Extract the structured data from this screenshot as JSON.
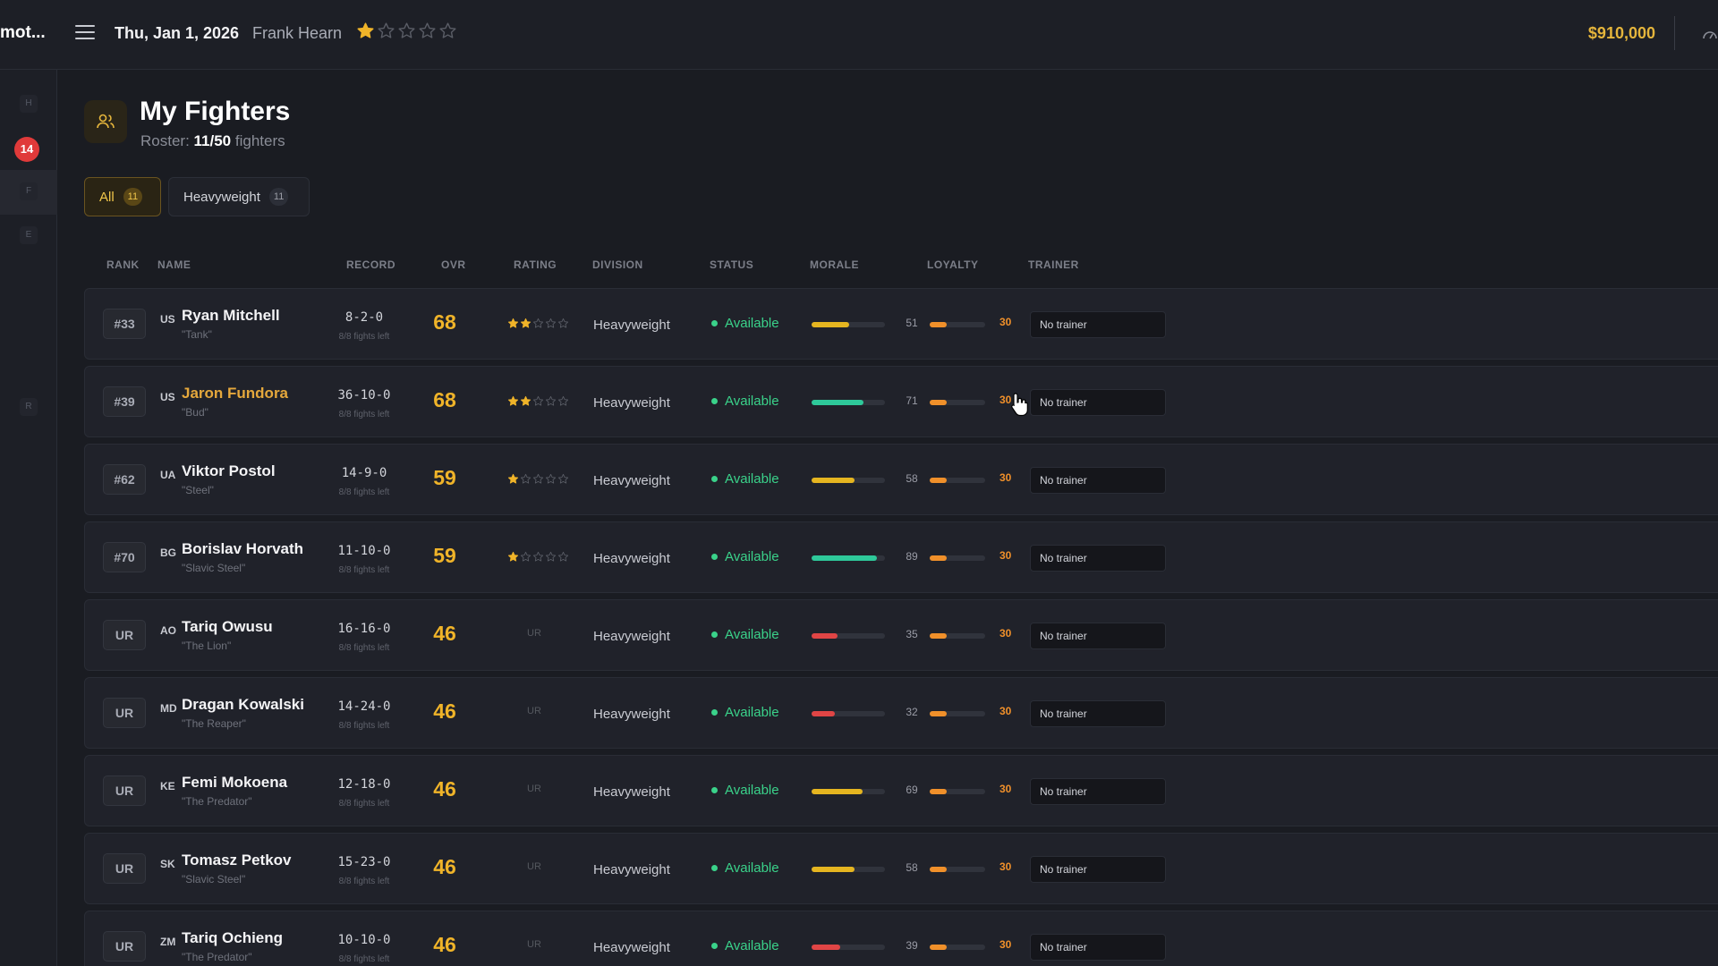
{
  "app": {
    "brand": "mot..."
  },
  "topbar": {
    "date": "Thu, Jan 1, 2026",
    "manager": "Frank Hearn",
    "stars": 1,
    "money": "$910,000"
  },
  "sidebar": {
    "items": [
      "H",
      "F",
      "E",
      "R"
    ],
    "badge": "14"
  },
  "page": {
    "title": "My Fighters",
    "roster_label": "Roster:",
    "roster_count": "11/50",
    "roster_suffix": "fighters"
  },
  "filters": [
    {
      "label": "All",
      "count": "11",
      "active": true
    },
    {
      "label": "Heavyweight",
      "count": "11",
      "active": false
    }
  ],
  "columns": [
    "RANK",
    "NAME",
    "RECORD",
    "OVR",
    "RATING",
    "DIVISION",
    "STATUS",
    "MORALE",
    "LOYALTY",
    "TRAINER"
  ],
  "colors": {
    "accent": "#f0b429",
    "available": "#3ad28a",
    "morale_green": "#2ec99a",
    "morale_yellow": "#e5b520",
    "morale_red": "#e04545",
    "loyalty": "#f0902a"
  },
  "fighters": [
    {
      "rank": "#33",
      "country": "US",
      "name": "Ryan Mitchell",
      "nickname": "\"Tank\"",
      "record": "8-2-0",
      "fights_left": "8/8 fights left",
      "ovr": "68",
      "stars": 2,
      "rating_text": "",
      "division": "Heavyweight",
      "status": "Available",
      "morale": 51,
      "morale_color": "yellow",
      "loyalty": 30,
      "trainer": "No trainer",
      "highlight": false
    },
    {
      "rank": "#39",
      "country": "US",
      "name": "Jaron Fundora",
      "nickname": "\"Bud\"",
      "record": "36-10-0",
      "fights_left": "8/8 fights left",
      "ovr": "68",
      "stars": 2,
      "rating_text": "",
      "division": "Heavyweight",
      "status": "Available",
      "morale": 71,
      "morale_color": "green",
      "loyalty": 30,
      "trainer": "No trainer",
      "highlight": true
    },
    {
      "rank": "#62",
      "country": "UA",
      "name": "Viktor Postol",
      "nickname": "\"Steel\"",
      "record": "14-9-0",
      "fights_left": "8/8 fights left",
      "ovr": "59",
      "stars": 1,
      "rating_text": "",
      "division": "Heavyweight",
      "status": "Available",
      "morale": 58,
      "morale_color": "yellow",
      "loyalty": 30,
      "trainer": "No trainer",
      "highlight": false
    },
    {
      "rank": "#70",
      "country": "BG",
      "name": "Borislav Horvath",
      "nickname": "\"Slavic Steel\"",
      "record": "11-10-0",
      "fights_left": "8/8 fights left",
      "ovr": "59",
      "stars": 1,
      "rating_text": "",
      "division": "Heavyweight",
      "status": "Available",
      "morale": 89,
      "morale_color": "green",
      "loyalty": 30,
      "trainer": "No trainer",
      "highlight": false
    },
    {
      "rank": "UR",
      "country": "AO",
      "name": "Tariq Owusu",
      "nickname": "\"The Lion\"",
      "record": "16-16-0",
      "fights_left": "8/8 fights left",
      "ovr": "46",
      "stars": 0,
      "rating_text": "UR",
      "division": "Heavyweight",
      "status": "Available",
      "morale": 35,
      "morale_color": "red",
      "loyalty": 30,
      "trainer": "No trainer",
      "highlight": false
    },
    {
      "rank": "UR",
      "country": "MD",
      "name": "Dragan Kowalski",
      "nickname": "\"The Reaper\"",
      "record": "14-24-0",
      "fights_left": "8/8 fights left",
      "ovr": "46",
      "stars": 0,
      "rating_text": "UR",
      "division": "Heavyweight",
      "status": "Available",
      "morale": 32,
      "morale_color": "red",
      "loyalty": 30,
      "trainer": "No trainer",
      "highlight": false
    },
    {
      "rank": "UR",
      "country": "KE",
      "name": "Femi Mokoena",
      "nickname": "\"The Predator\"",
      "record": "12-18-0",
      "fights_left": "8/8 fights left",
      "ovr": "46",
      "stars": 0,
      "rating_text": "UR",
      "division": "Heavyweight",
      "status": "Available",
      "morale": 69,
      "morale_color": "yellow",
      "loyalty": 30,
      "trainer": "No trainer",
      "highlight": false
    },
    {
      "rank": "UR",
      "country": "SK",
      "name": "Tomasz Petkov",
      "nickname": "\"Slavic Steel\"",
      "record": "15-23-0",
      "fights_left": "8/8 fights left",
      "ovr": "46",
      "stars": 0,
      "rating_text": "UR",
      "division": "Heavyweight",
      "status": "Available",
      "morale": 58,
      "morale_color": "yellow",
      "loyalty": 30,
      "trainer": "No trainer",
      "highlight": false
    },
    {
      "rank": "UR",
      "country": "ZM",
      "name": "Tariq Ochieng",
      "nickname": "\"The Predator\"",
      "record": "10-10-0",
      "fights_left": "8/8 fights left",
      "ovr": "46",
      "stars": 0,
      "rating_text": "UR",
      "division": "Heavyweight",
      "status": "Available",
      "morale": 39,
      "morale_color": "red",
      "loyalty": 30,
      "trainer": "No trainer",
      "highlight": false
    }
  ]
}
